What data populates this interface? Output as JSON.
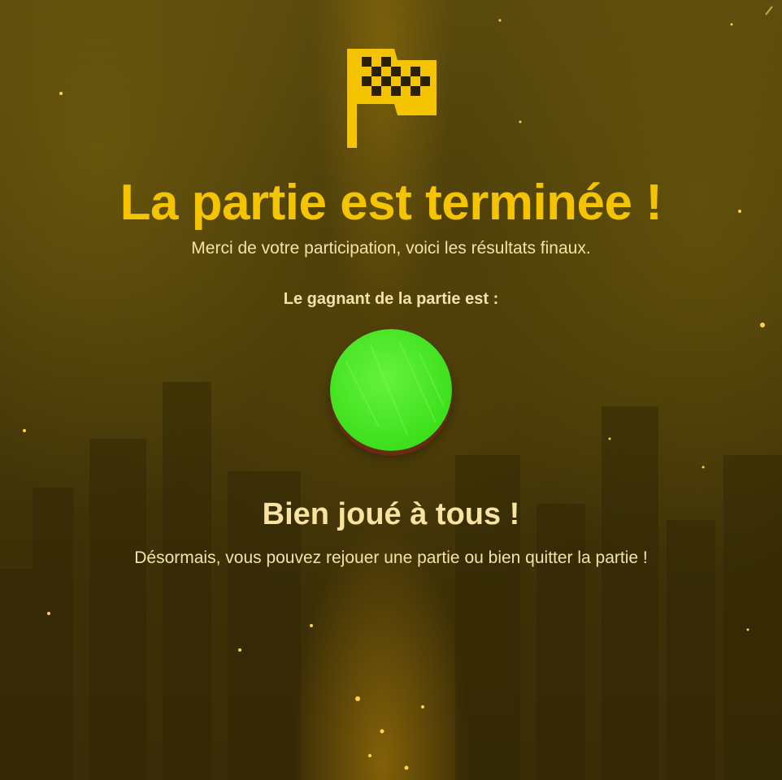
{
  "end_screen": {
    "title": "La partie est terminée !",
    "subtitle": "Merci de votre participation, voici les résultats finaux.",
    "winner_label": "Le gagnant de la partie est :",
    "winner_color": "#3ee81e",
    "congrats": "Bien joué à tous !",
    "description": "Désormais, vous pouvez rejouer une partie ou bien quitter la partie !"
  },
  "icons": {
    "header": "checkered-flag-icon"
  },
  "colors": {
    "accent": "#f5c400",
    "text": "#f3e3a6",
    "background": "#4a3c09"
  }
}
